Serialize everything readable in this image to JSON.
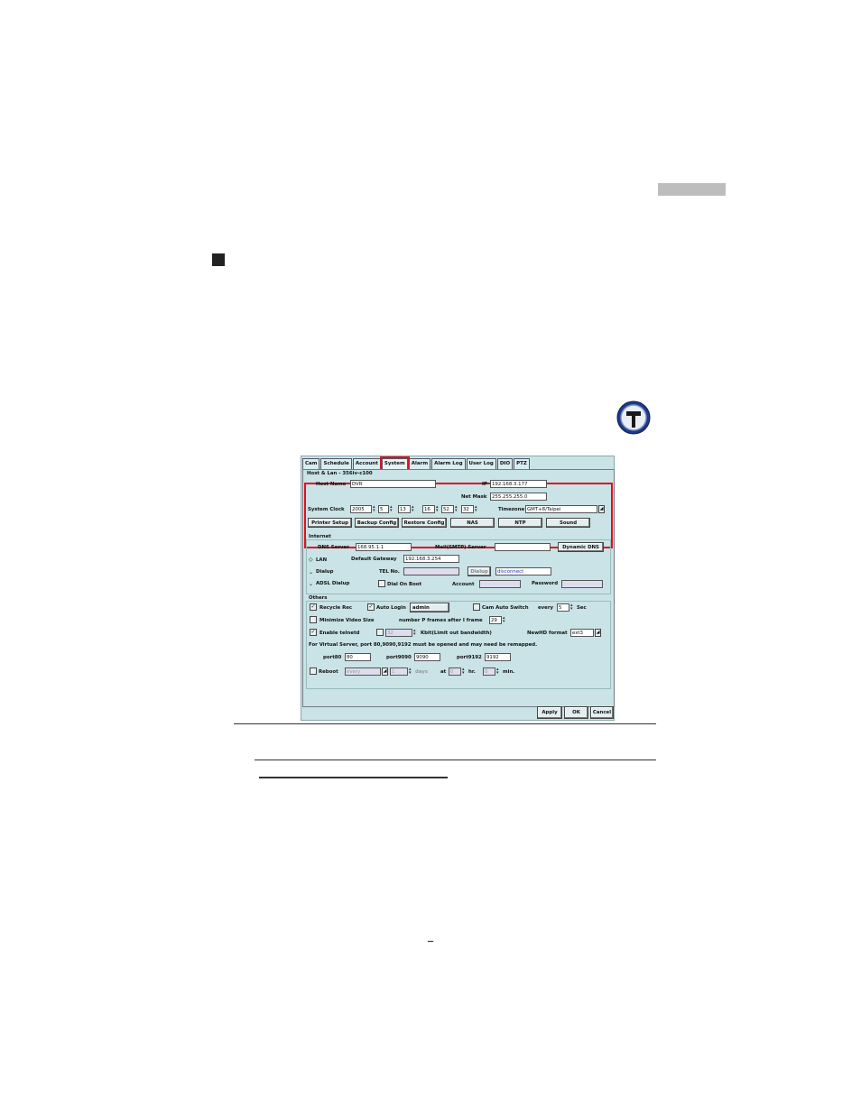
{
  "page": {
    "page_number": "_"
  },
  "dialog": {
    "tabs": [
      "Cam",
      "Schedule",
      "Account",
      "System",
      "Alarm",
      "Alarm Log",
      "User Log",
      "DIO",
      "PTZ"
    ],
    "selected_tab": "System",
    "host_lan": {
      "section_title": "Host & Lan - 356iv-c100",
      "host_name_label": "Host Name",
      "host_name_value": "DVR",
      "ip_label": "IP",
      "ip_value": "192.168.3.177",
      "net_mask_label": "Net Mask",
      "net_mask_value": "255.255.255.0",
      "system_clock_label": "System Clock",
      "clock_year": "2005",
      "clock_month": "5",
      "clock_day": "13",
      "clock_hour": "16",
      "clock_min": "52",
      "clock_sec": "32",
      "timezone_label": "Timezone",
      "timezone_value": "GMT+8/Taipei",
      "buttons": {
        "printer_setup": "Printer Setup",
        "backup_config": "Backup Config",
        "restore_config": "Restore Config",
        "nas": "NAS",
        "ntp": "NTP",
        "sound": "Sound"
      }
    },
    "internet": {
      "section_title": "Internet",
      "dns_server_label": "DNS Server",
      "dns_server_value": "168.95.1.1",
      "mail_server_label": "Mail(SMTP) Server",
      "mail_server_value": "",
      "dynamic_dns_button": "Dynamic DNS",
      "lan_label": "LAN",
      "default_gateway_label": "Default Gateway",
      "default_gateway_value": "192.168.3.254",
      "dialup_label": "Dialup",
      "tel_no_label": "TEL No.",
      "dialup_button": "Dialup",
      "dialup_status": "disconnect",
      "adsl_label": "ADSL Dialup",
      "dial_on_boot_label": "Dial On Boot",
      "account_label": "Account",
      "password_label": "Password"
    },
    "others": {
      "section_title": "Others",
      "recycle_rec_label": "Recycle Rec",
      "recycle_rec_checked": true,
      "auto_login_label": "Auto Login",
      "auto_login_checked": true,
      "auto_login_user": "admin",
      "cam_auto_switch_label": "Cam Auto Switch",
      "every_label": "every",
      "every_value": "5",
      "sec_label": "Sec",
      "minimize_video_label": "Minimize Video Size",
      "number_p_frames_label": "number P frames after I frame",
      "number_p_frames_value": "29",
      "enable_telnetd_label": "Enable telnetd",
      "enable_telnetd_checked": true,
      "kbit_value": "32",
      "kbit_label": "Kbit(Limit out bandwidth)",
      "newhd_format_label": "NewHD format",
      "newhd_format_value": "ext3",
      "virtual_server_note": "For Virtual Server, port 80,9090,9192 must be opened and may need be remapped.",
      "port80_label": "port80",
      "port80_value": "80",
      "port9090_label": "port9090",
      "port9090_value": "9090",
      "port9192_label": "port9192",
      "port9192_value": "9192",
      "reboot_label": "Reboot",
      "reboot_every": "every",
      "reboot_days_value": "1",
      "days_label": "days",
      "at_label": "at",
      "hr_value": "0",
      "hr_label": "hr.",
      "min_value": "0",
      "min_label": "min."
    },
    "footer": {
      "apply": "Apply",
      "ok": "OK",
      "cancel": "Cancel"
    }
  }
}
